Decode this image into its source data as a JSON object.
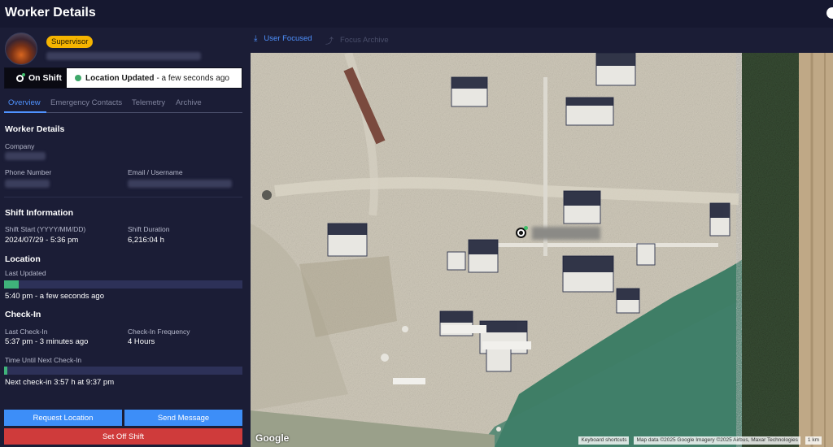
{
  "header": {
    "title": "Worker Details"
  },
  "worker": {
    "role_badge": "Supervisor",
    "shift_status": "On Shift",
    "location_status_bold": "Location Updated",
    "location_status_rest": "- a few seconds ago"
  },
  "tabs": [
    {
      "label": "Overview",
      "active": true
    },
    {
      "label": "Emergency Contacts",
      "active": false
    },
    {
      "label": "Telemetry",
      "active": false
    },
    {
      "label": "Archive",
      "active": false
    }
  ],
  "details": {
    "title": "Worker Details",
    "company_label": "Company",
    "phone_label": "Phone Number",
    "email_label": "Email / Username"
  },
  "shift": {
    "title": "Shift Information",
    "start_label": "Shift Start (YYYY/MM/DD)",
    "start_value": "2024/07/29 - 5:36 pm",
    "duration_label": "Shift Duration",
    "duration_value": "6,216:04 h"
  },
  "location": {
    "title": "Location",
    "last_updated_label": "Last Updated",
    "last_updated_progress": 0.06,
    "last_updated_value": "5:40 pm - a few seconds ago"
  },
  "checkin": {
    "title": "Check-In",
    "last_label": "Last Check-In",
    "last_value": "5:37 pm - 3 minutes ago",
    "freq_label": "Check-In Frequency",
    "freq_value": "4 Hours",
    "until_label": "Time Until Next Check-In",
    "until_progress": 0.015,
    "next_value": "Next check-in 3:57 h at 9:37 pm"
  },
  "actions": {
    "request_location": "Request Location",
    "send_message": "Send Message",
    "set_off_shift": "Set Off Shift"
  },
  "map": {
    "toolbar_user_focused": "User Focused",
    "toolbar_focus_archive": "Focus Archive",
    "google_logo": "Google",
    "keyboard_shortcuts": "Keyboard shortcuts",
    "map_data": "Map data ©2025 Google Imagery ©2025 Airbus, Maxar Technologies",
    "terms": "1 km"
  },
  "colors": {
    "accent": "#4f92ff",
    "badge": "#f5b400",
    "status_green": "#3fb37a",
    "danger": "#cf3b3b"
  }
}
